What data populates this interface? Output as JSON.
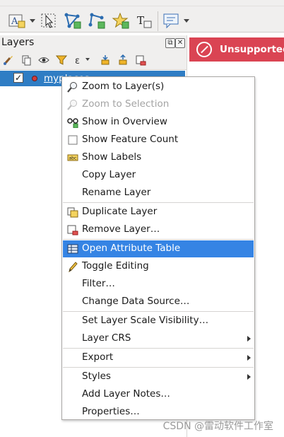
{
  "layers_panel": {
    "title": "Layers",
    "ctrl_float": "⧉",
    "ctrl_close": "✕"
  },
  "layer": {
    "name": "myplaces",
    "checked_glyph": "✓"
  },
  "message": {
    "text": "Unsupported"
  },
  "menu": {
    "items": [
      {
        "label": "Zoom to Layer(s)",
        "icon": "zoom-icon"
      },
      {
        "label": "Zoom to Selection",
        "icon": "zoom-selection-icon"
      },
      {
        "label": "Show in Overview",
        "icon": "overview-icon"
      },
      {
        "label": "Show Feature Count",
        "icon": "checkbox-icon"
      },
      {
        "label": "Show Labels",
        "icon": "labels-icon"
      },
      {
        "label": "Copy Layer",
        "icon": ""
      },
      {
        "label": "Rename Layer",
        "icon": ""
      },
      {
        "label": "Duplicate Layer",
        "icon": "duplicate-layer-icon"
      },
      {
        "label": "Remove Layer…",
        "icon": "remove-layer-icon"
      },
      {
        "label": "Open Attribute Table",
        "icon": "attribute-table-icon"
      },
      {
        "label": "Toggle Editing",
        "icon": "pencil-icon"
      },
      {
        "label": "Filter…",
        "icon": ""
      },
      {
        "label": "Change Data Source…",
        "icon": ""
      },
      {
        "label": "Set Layer Scale Visibility…",
        "icon": ""
      },
      {
        "label": "Layer CRS",
        "icon": ""
      },
      {
        "label": "Export",
        "icon": ""
      },
      {
        "label": "Styles",
        "icon": ""
      },
      {
        "label": "Add Layer Notes…",
        "icon": ""
      },
      {
        "label": "Properties…",
        "icon": ""
      }
    ]
  },
  "watermark": "CSDN @雷动软件工作室",
  "colors": {
    "highlight": "#3584e4",
    "layer_selected": "#2f7dc4",
    "error_bar": "#da4453"
  }
}
